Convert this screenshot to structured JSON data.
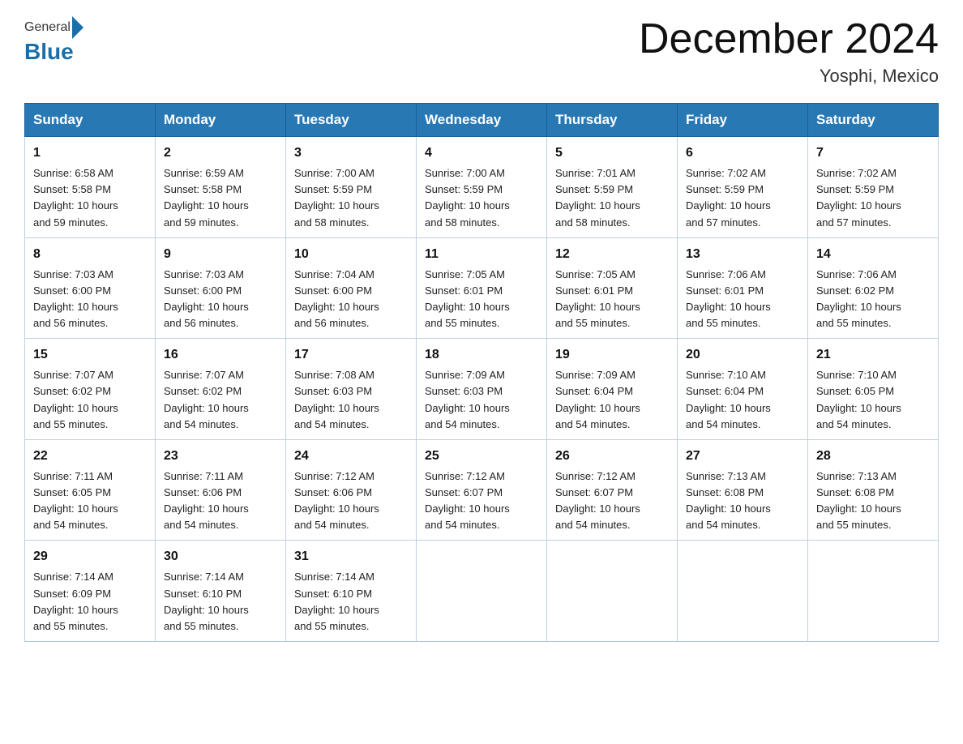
{
  "header": {
    "logo": {
      "general": "General",
      "blue": "Blue"
    },
    "title": "December 2024",
    "location": "Yosphi, Mexico"
  },
  "days_of_week": [
    "Sunday",
    "Monday",
    "Tuesday",
    "Wednesday",
    "Thursday",
    "Friday",
    "Saturday"
  ],
  "weeks": [
    [
      {
        "day": "1",
        "sunrise": "6:58 AM",
        "sunset": "5:58 PM",
        "daylight": "10 hours and 59 minutes."
      },
      {
        "day": "2",
        "sunrise": "6:59 AM",
        "sunset": "5:58 PM",
        "daylight": "10 hours and 59 minutes."
      },
      {
        "day": "3",
        "sunrise": "7:00 AM",
        "sunset": "5:59 PM",
        "daylight": "10 hours and 58 minutes."
      },
      {
        "day": "4",
        "sunrise": "7:00 AM",
        "sunset": "5:59 PM",
        "daylight": "10 hours and 58 minutes."
      },
      {
        "day": "5",
        "sunrise": "7:01 AM",
        "sunset": "5:59 PM",
        "daylight": "10 hours and 58 minutes."
      },
      {
        "day": "6",
        "sunrise": "7:02 AM",
        "sunset": "5:59 PM",
        "daylight": "10 hours and 57 minutes."
      },
      {
        "day": "7",
        "sunrise": "7:02 AM",
        "sunset": "5:59 PM",
        "daylight": "10 hours and 57 minutes."
      }
    ],
    [
      {
        "day": "8",
        "sunrise": "7:03 AM",
        "sunset": "6:00 PM",
        "daylight": "10 hours and 56 minutes."
      },
      {
        "day": "9",
        "sunrise": "7:03 AM",
        "sunset": "6:00 PM",
        "daylight": "10 hours and 56 minutes."
      },
      {
        "day": "10",
        "sunrise": "7:04 AM",
        "sunset": "6:00 PM",
        "daylight": "10 hours and 56 minutes."
      },
      {
        "day": "11",
        "sunrise": "7:05 AM",
        "sunset": "6:01 PM",
        "daylight": "10 hours and 55 minutes."
      },
      {
        "day": "12",
        "sunrise": "7:05 AM",
        "sunset": "6:01 PM",
        "daylight": "10 hours and 55 minutes."
      },
      {
        "day": "13",
        "sunrise": "7:06 AM",
        "sunset": "6:01 PM",
        "daylight": "10 hours and 55 minutes."
      },
      {
        "day": "14",
        "sunrise": "7:06 AM",
        "sunset": "6:02 PM",
        "daylight": "10 hours and 55 minutes."
      }
    ],
    [
      {
        "day": "15",
        "sunrise": "7:07 AM",
        "sunset": "6:02 PM",
        "daylight": "10 hours and 55 minutes."
      },
      {
        "day": "16",
        "sunrise": "7:07 AM",
        "sunset": "6:02 PM",
        "daylight": "10 hours and 54 minutes."
      },
      {
        "day": "17",
        "sunrise": "7:08 AM",
        "sunset": "6:03 PM",
        "daylight": "10 hours and 54 minutes."
      },
      {
        "day": "18",
        "sunrise": "7:09 AM",
        "sunset": "6:03 PM",
        "daylight": "10 hours and 54 minutes."
      },
      {
        "day": "19",
        "sunrise": "7:09 AM",
        "sunset": "6:04 PM",
        "daylight": "10 hours and 54 minutes."
      },
      {
        "day": "20",
        "sunrise": "7:10 AM",
        "sunset": "6:04 PM",
        "daylight": "10 hours and 54 minutes."
      },
      {
        "day": "21",
        "sunrise": "7:10 AM",
        "sunset": "6:05 PM",
        "daylight": "10 hours and 54 minutes."
      }
    ],
    [
      {
        "day": "22",
        "sunrise": "7:11 AM",
        "sunset": "6:05 PM",
        "daylight": "10 hours and 54 minutes."
      },
      {
        "day": "23",
        "sunrise": "7:11 AM",
        "sunset": "6:06 PM",
        "daylight": "10 hours and 54 minutes."
      },
      {
        "day": "24",
        "sunrise": "7:12 AM",
        "sunset": "6:06 PM",
        "daylight": "10 hours and 54 minutes."
      },
      {
        "day": "25",
        "sunrise": "7:12 AM",
        "sunset": "6:07 PM",
        "daylight": "10 hours and 54 minutes."
      },
      {
        "day": "26",
        "sunrise": "7:12 AM",
        "sunset": "6:07 PM",
        "daylight": "10 hours and 54 minutes."
      },
      {
        "day": "27",
        "sunrise": "7:13 AM",
        "sunset": "6:08 PM",
        "daylight": "10 hours and 54 minutes."
      },
      {
        "day": "28",
        "sunrise": "7:13 AM",
        "sunset": "6:08 PM",
        "daylight": "10 hours and 55 minutes."
      }
    ],
    [
      {
        "day": "29",
        "sunrise": "7:14 AM",
        "sunset": "6:09 PM",
        "daylight": "10 hours and 55 minutes."
      },
      {
        "day": "30",
        "sunrise": "7:14 AM",
        "sunset": "6:10 PM",
        "daylight": "10 hours and 55 minutes."
      },
      {
        "day": "31",
        "sunrise": "7:14 AM",
        "sunset": "6:10 PM",
        "daylight": "10 hours and 55 minutes."
      },
      null,
      null,
      null,
      null
    ]
  ],
  "labels": {
    "sunrise_prefix": "Sunrise: ",
    "sunset_prefix": "Sunset: ",
    "daylight_prefix": "Daylight: "
  }
}
